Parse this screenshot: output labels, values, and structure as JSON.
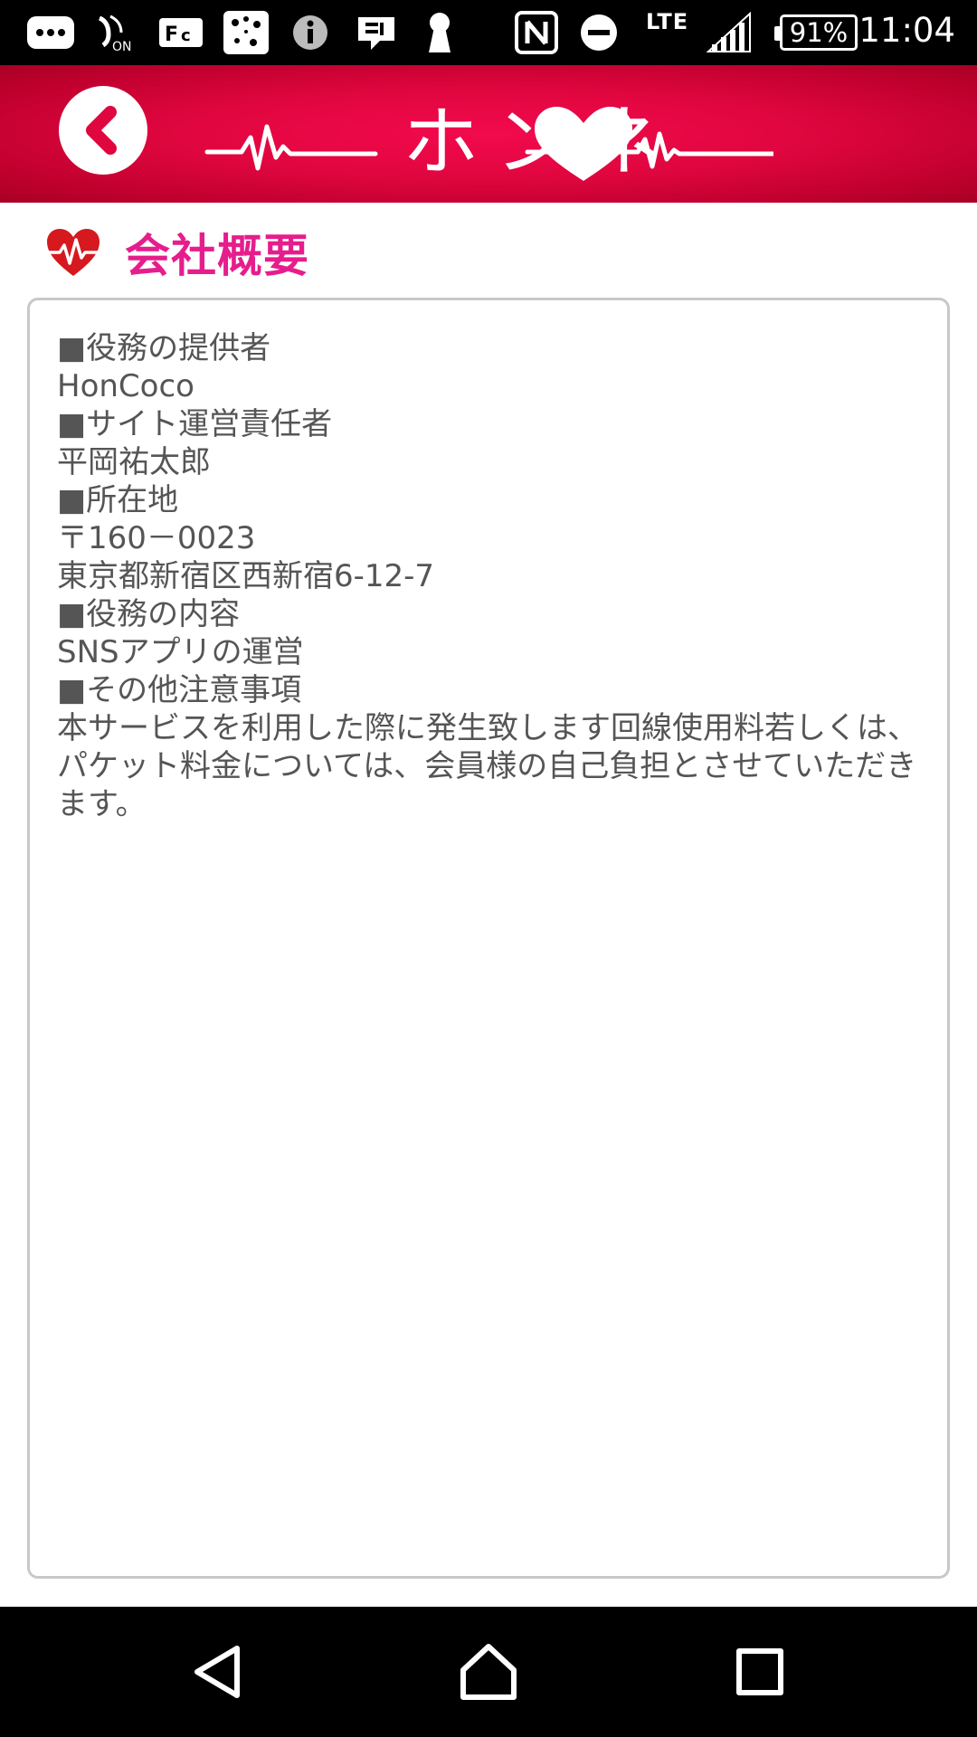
{
  "status_bar": {
    "lte_label": "LTE",
    "battery_label": "91%",
    "clock": "11:04",
    "icons": [
      "more-icon",
      "wifi-calling-icon",
      "fc-icon",
      "connect-icon",
      "info-icon",
      "chat-icon",
      "keyhole-icon",
      "nfc-icon",
      "do-not-disturb-icon",
      "signal-icon",
      "battery-icon"
    ]
  },
  "header": {
    "logo_text": "ホンネ",
    "back_icon": "chevron-left-icon",
    "accent_color": "#e0063f"
  },
  "section": {
    "title": "会社概要",
    "title_color": "#e61d8c",
    "icon": "heartbeat-icon"
  },
  "content": {
    "lines": [
      "■役務の提供者",
      "HonCoco",
      "■サイト運営責任者",
      "平岡祐太郎",
      "■所在地",
      "〒160－0023",
      "東京都新宿区西新宿6-12-7",
      "■役務の内容",
      "SNSアプリの運営",
      "■その他注意事項",
      "本サービスを利用した際に発生致します回線使用料若しくは、パケット料金については、会員様の自己負担とさせていただきます。"
    ]
  },
  "nav_bar": {
    "icons": [
      "back-triangle-icon",
      "home-icon",
      "recents-icon"
    ]
  }
}
